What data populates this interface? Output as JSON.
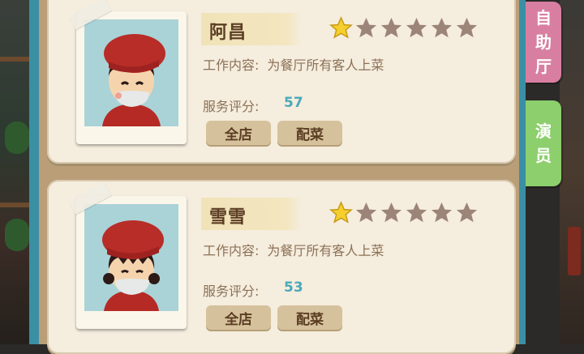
{
  "cards": [
    {
      "name": "阿昌",
      "stars_filled": 1,
      "stars_total": 6,
      "duty_label": "工作内容:",
      "duty_value": "为餐厅所有客人上菜",
      "score_label": "服务评分:",
      "score_value": "57",
      "btn_all": "全店",
      "btn_dish": "配菜"
    },
    {
      "name": "雪雪",
      "stars_filled": 1,
      "stars_total": 6,
      "duty_label": "工作内容:",
      "duty_value": "为餐厅所有客人上菜",
      "score_label": "服务评分:",
      "score_value": "53",
      "btn_all": "全店",
      "btn_dish": "配菜"
    }
  ],
  "tabs": {
    "buffet_chars": [
      "自",
      "助",
      "厅"
    ],
    "actor_chars": [
      "演",
      "员"
    ]
  },
  "colors": {
    "star_filled": "#f4cf2e",
    "star_empty": "#9c8479",
    "score": "#49a9b9",
    "tab_buffet": "#d87fa1",
    "tab_actor": "#8ccf6c"
  }
}
